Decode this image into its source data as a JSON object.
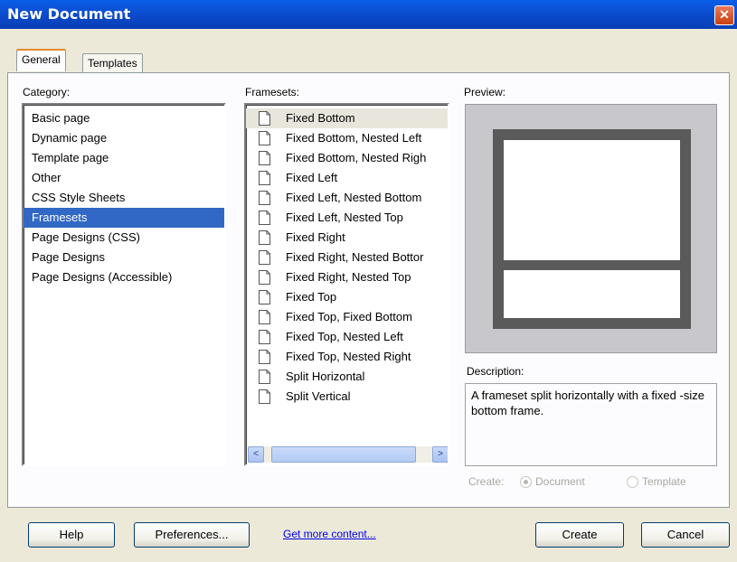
{
  "window": {
    "title": "New Document",
    "close_icon": "close-icon"
  },
  "tabs": [
    {
      "label": "General",
      "active": true
    },
    {
      "label": "Templates",
      "active": false
    }
  ],
  "category": {
    "label": "Category:",
    "items": [
      "Basic page",
      "Dynamic page",
      "Template page",
      "Other",
      "CSS Style Sheets",
      "Framesets",
      "Page Designs (CSS)",
      "Page Designs",
      "Page Designs (Accessible)"
    ],
    "selected": "Framesets"
  },
  "framesets": {
    "label": "Framesets:",
    "items": [
      "Fixed Bottom",
      "Fixed Bottom, Nested Left",
      "Fixed Bottom, Nested Righ",
      "Fixed Left",
      "Fixed Left, Nested Bottom",
      "Fixed Left, Nested Top",
      "Fixed Right",
      "Fixed Right, Nested Bottor",
      "Fixed Right, Nested Top",
      "Fixed Top",
      "Fixed Top, Fixed Bottom",
      "Fixed Top, Nested Left",
      "Fixed Top, Nested Right",
      "Split Horizontal",
      "Split Vertical"
    ],
    "selected": "Fixed Bottom"
  },
  "preview": {
    "label": "Preview:"
  },
  "description": {
    "label": "Description:",
    "text": "A frameset split horizontally with a fixed -size bottom frame."
  },
  "create_options": {
    "label": "Create:",
    "document_label": "Document",
    "template_label": "Template",
    "selected": "Document"
  },
  "buttons": {
    "help": "Help",
    "preferences": "Preferences...",
    "get_more": "Get more content...",
    "create": "Create",
    "cancel": "Cancel"
  },
  "colors": {
    "title_bar": "#0b48c8",
    "selection": "#3168c5",
    "dialog_bg": "#ece9d8"
  }
}
